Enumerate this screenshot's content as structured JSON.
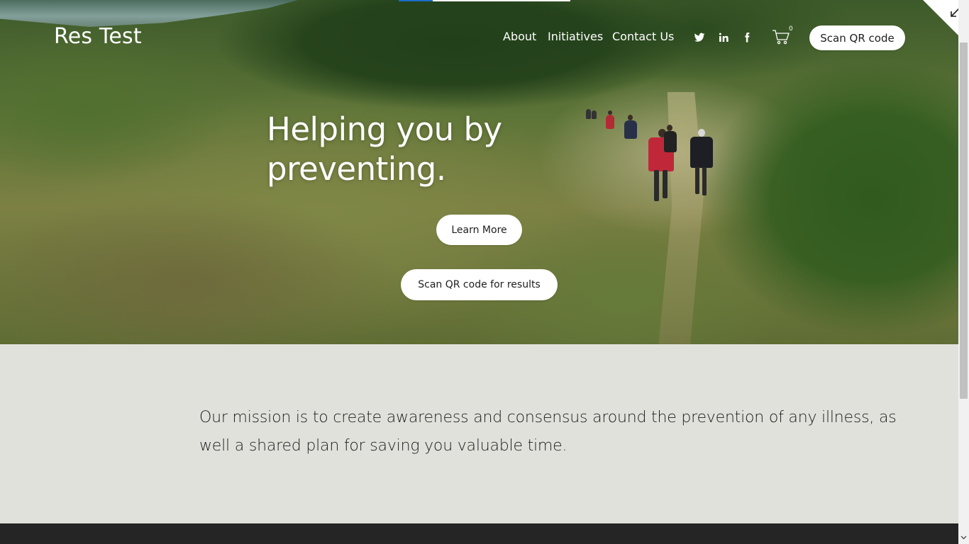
{
  "brand": {
    "name": "Res Test"
  },
  "nav": {
    "links": [
      "About",
      "Initiatives",
      "Contact Us"
    ],
    "social_icons": [
      "twitter-icon",
      "linkedin-icon",
      "facebook-icon"
    ],
    "cart_count": "0",
    "cta_label": "Scan QR code"
  },
  "hero": {
    "headline_line1": "Helping you by",
    "headline_line2": "preventing.",
    "learn_more_label": "Learn More",
    "scan_results_label": "Scan QR code for results"
  },
  "mission": {
    "text": "Our mission is to create awareness and consensus around the prevention of any illness, as well a shared plan for saving you valuable time."
  },
  "colors": {
    "mission_bg": "#e1e1dc",
    "footer_bg": "#262525",
    "button_bg": "#ffffff",
    "accent_blue": "#1a6ec7"
  },
  "icons": {
    "corner": "collapse-arrow-icon",
    "cart": "cart-icon"
  }
}
